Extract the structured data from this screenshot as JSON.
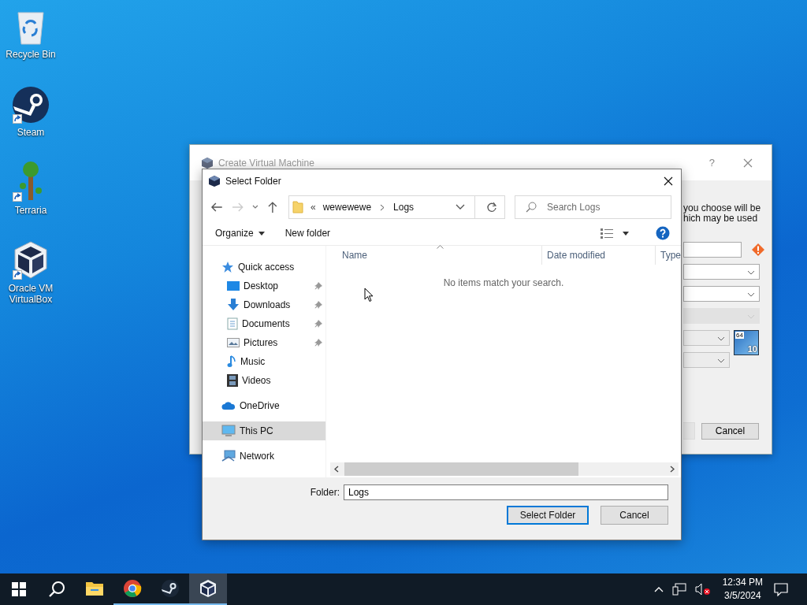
{
  "desktop_icons": [
    {
      "kind": "recycle-bin",
      "label": "Recycle Bin",
      "shortcut": false
    },
    {
      "kind": "steam",
      "label": "Steam",
      "shortcut": true
    },
    {
      "kind": "terraria",
      "label": "Terraria",
      "shortcut": true
    },
    {
      "kind": "virtualbox",
      "label": "Oracle VM VirtualBox",
      "shortcut": true
    }
  ],
  "background_window": {
    "title": "Create Virtual Machine",
    "help": "?",
    "text_lines": [
      "you choose will be",
      "hich may be used"
    ],
    "fields": [
      {
        "kind": "text",
        "warning": true,
        "disabled": false
      },
      {
        "kind": "combo",
        "warning": false,
        "disabled": false
      },
      {
        "kind": "combo",
        "warning": false,
        "disabled": false
      },
      {
        "kind": "combo",
        "warning": false,
        "disabled": true
      },
      {
        "kind": "combo-small",
        "warning": false,
        "disabled": false
      },
      {
        "kind": "combo-small",
        "warning": false,
        "disabled": false
      }
    ],
    "os_badge": {
      "bits": "64",
      "version": "10"
    },
    "buttons": [
      {
        "label": "Cancel"
      }
    ]
  },
  "dialog": {
    "title": "Select Folder",
    "address": {
      "overflow": "«",
      "crumbs": [
        "wewewewe",
        "Logs"
      ]
    },
    "search": {
      "placeholder": "Search Logs"
    },
    "toolbar": {
      "organize": "Organize",
      "new_folder": "New folder"
    },
    "nav": [
      {
        "label": "Quick access",
        "selected": false,
        "children": [
          {
            "label": "Desktop",
            "pinned": true,
            "selected": false
          },
          {
            "label": "Downloads",
            "pinned": true,
            "selected": false
          },
          {
            "label": "Documents",
            "pinned": true,
            "selected": false
          },
          {
            "label": "Pictures",
            "pinned": true,
            "selected": false
          },
          {
            "label": "Music",
            "pinned": false,
            "selected": false
          },
          {
            "label": "Videos",
            "pinned": false,
            "selected": false
          }
        ]
      },
      {
        "label": "OneDrive",
        "selected": false
      },
      {
        "label": "This PC",
        "selected": true
      },
      {
        "label": "Network",
        "selected": false
      }
    ],
    "columns": [
      {
        "label": "Name",
        "sorted": true
      },
      {
        "label": "Date modified",
        "sorted": false
      },
      {
        "label": "Type",
        "sorted": false
      }
    ],
    "empty_message": "No items match your search.",
    "folder_label": "Folder:",
    "folder_value": "Logs",
    "buttons": [
      {
        "label": "Select Folder",
        "default": true
      },
      {
        "label": "Cancel",
        "default": false
      }
    ]
  },
  "taskbar": {
    "apps": [
      {
        "kind": "explorer",
        "running": false,
        "active": false
      },
      {
        "kind": "chrome",
        "running": true,
        "active": false
      },
      {
        "kind": "steam",
        "running": true,
        "active": false
      },
      {
        "kind": "virtualbox",
        "running": true,
        "active": true
      }
    ],
    "volume_muted": true,
    "time": "12:34 PM",
    "date": "3/5/2024"
  }
}
